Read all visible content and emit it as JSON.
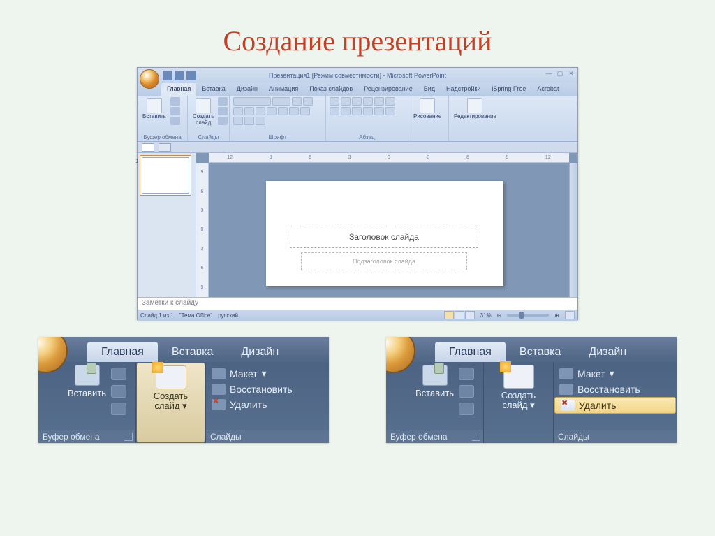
{
  "page_title": "Создание презентаций",
  "window": {
    "title": "Презентация1 [Режим совместимости] - Microsoft PowerPoint",
    "tabs": [
      "Главная",
      "Вставка",
      "Дизайн",
      "Анимация",
      "Показ слайдов",
      "Рецензирование",
      "Вид",
      "Надстройки",
      "iSpring Free",
      "Acrobat"
    ],
    "active_tab": "Главная",
    "groups": {
      "clipboard": {
        "label": "Буфер обмена",
        "paste": "Вставить"
      },
      "slides": {
        "label": "Слайды",
        "new": "Создать\nслайд"
      },
      "font": {
        "label": "Шрифт"
      },
      "paragraph": {
        "label": "Абзац"
      },
      "drawing": {
        "label": "Рисование"
      },
      "editing": {
        "label": "Редактирование"
      }
    },
    "ruler_h": [
      "12",
      "9",
      "6",
      "3",
      "0",
      "3",
      "6",
      "9",
      "12"
    ],
    "ruler_v": [
      "9",
      "6",
      "3",
      "0",
      "3",
      "6",
      "9"
    ],
    "thumb_num": "1",
    "slide": {
      "title": "Заголовок слайда",
      "sub": "Подзаголовок слайда"
    },
    "notes": "Заметки к слайду",
    "status": {
      "slide": "Слайд 1 из 1",
      "theme": "\"Тема Office\"",
      "lang": "русский",
      "zoom": "31%"
    }
  },
  "zoom_panel": {
    "tabs": [
      "Главная",
      "Вставка",
      "Дизайн"
    ],
    "g1_label": "Буфер обмена",
    "paste": "Вставить",
    "g2_new_line1": "Создать",
    "g2_new_line2": "слайд",
    "g3_label": "Слайды",
    "opt_layout": "Макет",
    "opt_reset": "Восстановить",
    "opt_delete": "Удалить"
  }
}
